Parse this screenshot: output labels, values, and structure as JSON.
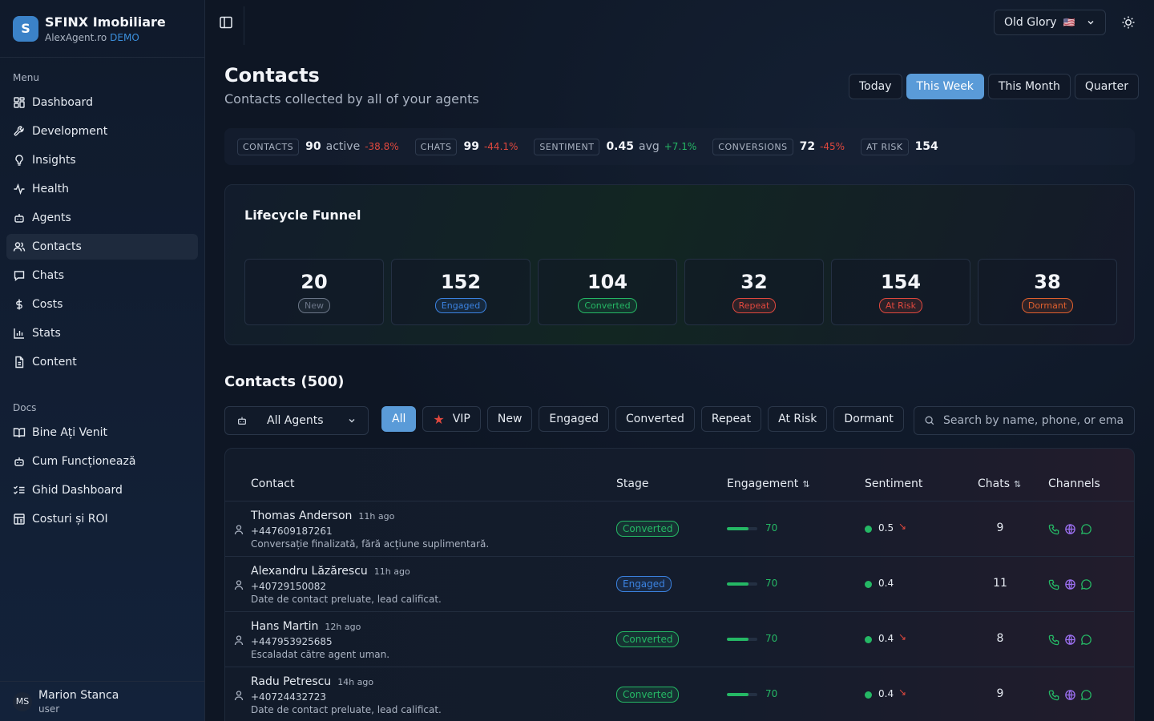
{
  "brand": {
    "logo_letter": "S",
    "name": "SFINX Imobiliare",
    "domain": "AlexAgent.ro",
    "badge": "DEMO"
  },
  "sidebar": {
    "menu_label": "Menu",
    "items": [
      {
        "label": "Dashboard",
        "icon": "dashboard-icon"
      },
      {
        "label": "Development",
        "icon": "wrench-icon"
      },
      {
        "label": "Insights",
        "icon": "lightbulb-icon"
      },
      {
        "label": "Health",
        "icon": "activity-icon"
      },
      {
        "label": "Agents",
        "icon": "bot-icon"
      },
      {
        "label": "Contacts",
        "icon": "users-icon",
        "active": true
      },
      {
        "label": "Chats",
        "icon": "message-icon"
      },
      {
        "label": "Costs",
        "icon": "dollar-icon"
      },
      {
        "label": "Stats",
        "icon": "bar-chart-icon"
      },
      {
        "label": "Content",
        "icon": "file-icon"
      }
    ],
    "docs_label": "Docs",
    "docs": [
      {
        "label": "Bine Ați Venit",
        "icon": "book-icon"
      },
      {
        "label": "Cum Funcționează",
        "icon": "bot-icon"
      },
      {
        "label": "Ghid Dashboard",
        "icon": "list-checks-icon"
      },
      {
        "label": "Costuri și ROI",
        "icon": "receipt-icon"
      }
    ],
    "user": {
      "initials": "MS",
      "name": "Marion Stanca",
      "role": "user"
    }
  },
  "topbar": {
    "workspace": "Old Glory",
    "workspace_flag": "🇺🇸"
  },
  "page": {
    "title": "Contacts",
    "subtitle": "Contacts collected by all of your agents"
  },
  "periods": [
    {
      "label": "Today"
    },
    {
      "label": "This Week",
      "active": true
    },
    {
      "label": "This Month"
    },
    {
      "label": "Quarter"
    }
  ],
  "stats": [
    {
      "label": "CONTACTS",
      "value": "90",
      "unit": "active",
      "delta": "-38.8%",
      "trend": "neg"
    },
    {
      "label": "CHATS",
      "value": "99",
      "unit": "",
      "delta": "-44.1%",
      "trend": "neg"
    },
    {
      "label": "SENTIMENT",
      "value": "0.45",
      "unit": "avg",
      "delta": "+7.1%",
      "trend": "pos"
    },
    {
      "label": "CONVERSIONS",
      "value": "72",
      "unit": "",
      "delta": "-45%",
      "trend": "neg"
    },
    {
      "label": "AT RISK",
      "value": "154",
      "unit": "",
      "delta": "",
      "trend": ""
    }
  ],
  "funnel": {
    "title": "Lifecycle Funnel",
    "stages": [
      {
        "count": "20",
        "label": "New",
        "color": "#6b7688"
      },
      {
        "count": "152",
        "label": "Engaged",
        "color": "#3b82e0"
      },
      {
        "count": "104",
        "label": "Converted",
        "color": "#25b865"
      },
      {
        "count": "32",
        "label": "Repeat",
        "color": "#e0483e"
      },
      {
        "count": "154",
        "label": "At Risk",
        "color": "#e0483e"
      },
      {
        "count": "38",
        "label": "Dormant",
        "color": "#e0602e"
      }
    ]
  },
  "contacts": {
    "title": "Contacts (500)",
    "agent_filter": "All Agents",
    "filters": [
      {
        "label": "All",
        "active": true
      },
      {
        "label": "VIP",
        "star": true
      },
      {
        "label": "New"
      },
      {
        "label": "Engaged"
      },
      {
        "label": "Converted"
      },
      {
        "label": "Repeat"
      },
      {
        "label": "At Risk"
      },
      {
        "label": "Dormant"
      }
    ],
    "search_placeholder": "Search by name, phone, or email...",
    "columns": {
      "contact": "Contact",
      "stage": "Stage",
      "engagement": "Engagement",
      "sentiment": "Sentiment",
      "chats": "Chats",
      "channels": "Channels"
    },
    "rows": [
      {
        "name": "Thomas Anderson",
        "ago": "11h ago",
        "phone": "+447609187261",
        "note": "Conversație finalizată, fără acțiune suplimentară.",
        "stage": "Converted",
        "stage_color": "#25b865",
        "engagement": 70,
        "sentiment": "0.5",
        "trend": "down",
        "chats": "9"
      },
      {
        "name": "Alexandru Lăzărescu",
        "ago": "11h ago",
        "phone": "+40729150082",
        "note": "Date de contact preluate, lead calificat.",
        "stage": "Engaged",
        "stage_color": "#3b82e0",
        "engagement": 70,
        "sentiment": "0.4",
        "trend": "",
        "chats": "11"
      },
      {
        "name": "Hans Martin",
        "ago": "12h ago",
        "phone": "+447953925685",
        "note": "Escaladat către agent uman.",
        "stage": "Converted",
        "stage_color": "#25b865",
        "engagement": 70,
        "sentiment": "0.4",
        "trend": "down",
        "chats": "8"
      },
      {
        "name": "Radu Petrescu",
        "ago": "14h ago",
        "phone": "+40724432723",
        "note": "Date de contact preluate, lead calificat.",
        "stage": "Converted",
        "stage_color": "#25b865",
        "engagement": 70,
        "sentiment": "0.4",
        "trend": "down",
        "chats": "9"
      }
    ]
  }
}
